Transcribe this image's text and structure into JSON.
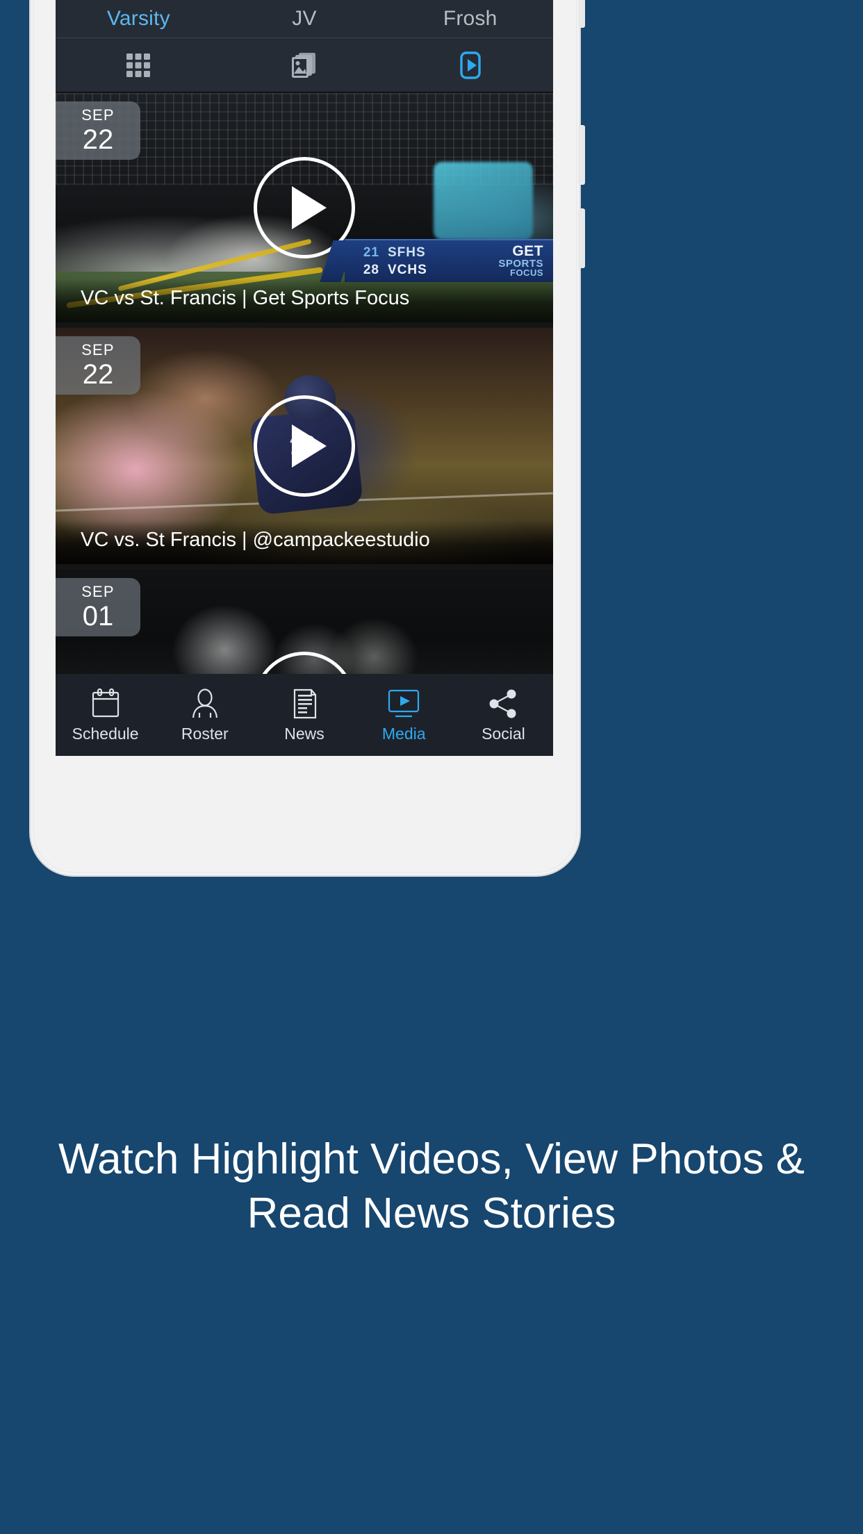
{
  "background_color": "#17466f",
  "accent_color": "#2fa9ef",
  "app": {
    "team_tabs": [
      {
        "label": "Varsity",
        "active": true
      },
      {
        "label": "JV",
        "active": false
      },
      {
        "label": "Frosh",
        "active": false
      }
    ],
    "media_tabs": [
      {
        "name": "grid-view",
        "icon": "grid-icon",
        "active": false
      },
      {
        "name": "photos-view",
        "icon": "photo-icon",
        "active": false
      },
      {
        "name": "videos-view",
        "icon": "video-play-icon",
        "active": true
      }
    ],
    "videos": [
      {
        "month": "SEP",
        "day": "22",
        "title": "VC vs St. Francis | Get Sports Focus",
        "scorebug": {
          "away_score": "21",
          "away_team": "SFHS",
          "home_score": "28",
          "home_team": "VCHS",
          "logo_line1": "GET",
          "logo_line2": "SPORTS",
          "logo_line3": "FOCUS"
        }
      },
      {
        "month": "SEP",
        "day": "22",
        "title": "VC vs. St Francis | @campackeestudio"
      },
      {
        "month": "SEP",
        "day": "01",
        "title": ""
      }
    ],
    "bottom_nav": [
      {
        "label": "Schedule",
        "icon": "calendar-icon",
        "active": false
      },
      {
        "label": "Roster",
        "icon": "person-icon",
        "active": false
      },
      {
        "label": "News",
        "icon": "document-icon",
        "active": false
      },
      {
        "label": "Media",
        "icon": "monitor-play-icon",
        "active": true
      },
      {
        "label": "Social",
        "icon": "share-icon",
        "active": false
      }
    ]
  },
  "tagline": "Watch Highlight Videos, View Photos & Read News Stories"
}
